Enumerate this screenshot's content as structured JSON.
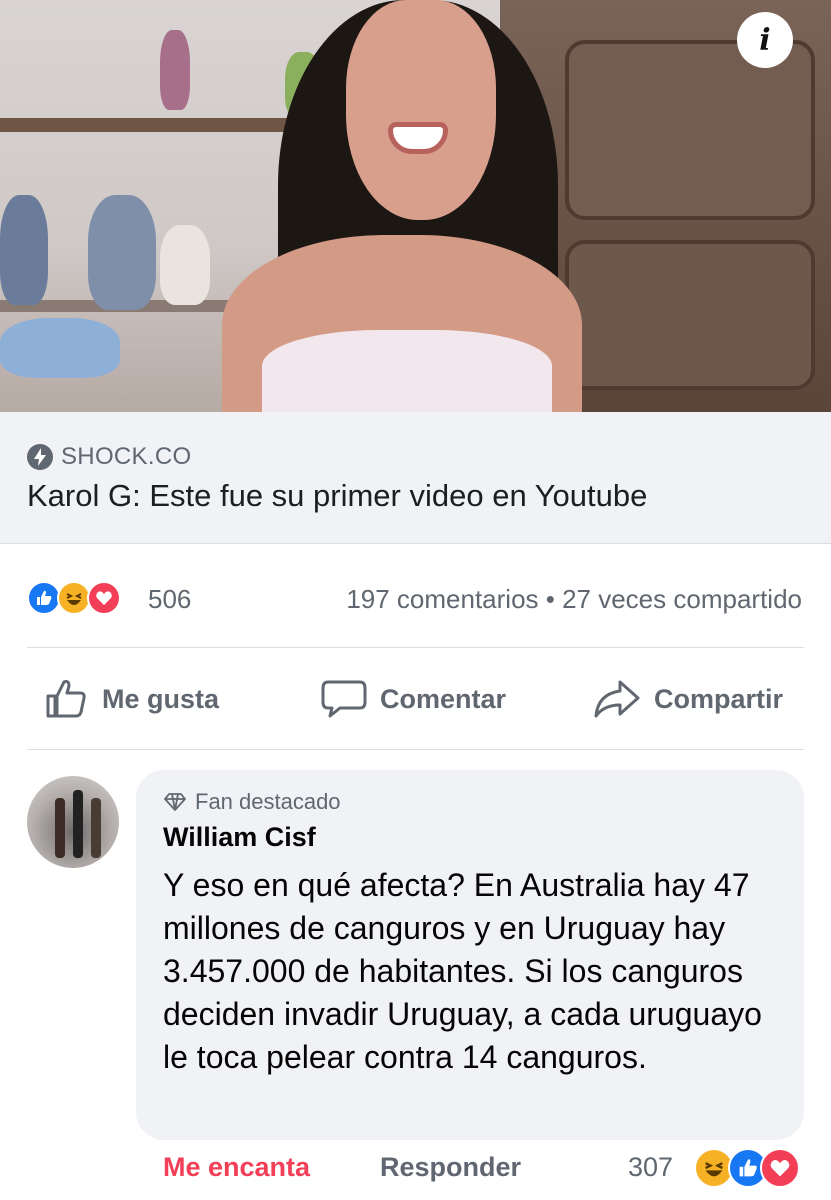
{
  "preview": {
    "info_icon": "info-icon",
    "info_glyph": "i"
  },
  "link": {
    "source_icon": "bolt-icon",
    "source": "SHOCK.CO",
    "title": "Karol G: Este fue su primer video en Youtube"
  },
  "summary": {
    "reactions": [
      "like",
      "haha",
      "love"
    ],
    "reaction_count": "506",
    "comments_shares": "197 comentarios • 27 veces compartido"
  },
  "actions": {
    "like_label": "Me gusta",
    "comment_label": "Comentar",
    "share_label": "Compartir"
  },
  "comment": {
    "badge": "Fan destacado",
    "author": "William Cisf",
    "text": "Y eso en qué afecta? En Australia hay 47 millones de canguros y en Uruguay hay 3.457.000 de habitantes. Si los canguros deciden invadir Uruguay, a cada uruguayo le toca pelear contra 14 canguros.",
    "love_label": "Me encanta",
    "reply_label": "Responder",
    "reaction_count": "307",
    "reactions": [
      "haha",
      "like",
      "love"
    ]
  },
  "colors": {
    "like_blue": "#1877f2",
    "haha_yellow": "#f7b125",
    "love_red": "#f33e58",
    "secondary_text": "#606770",
    "bubble_bg": "#f0f2f5"
  }
}
